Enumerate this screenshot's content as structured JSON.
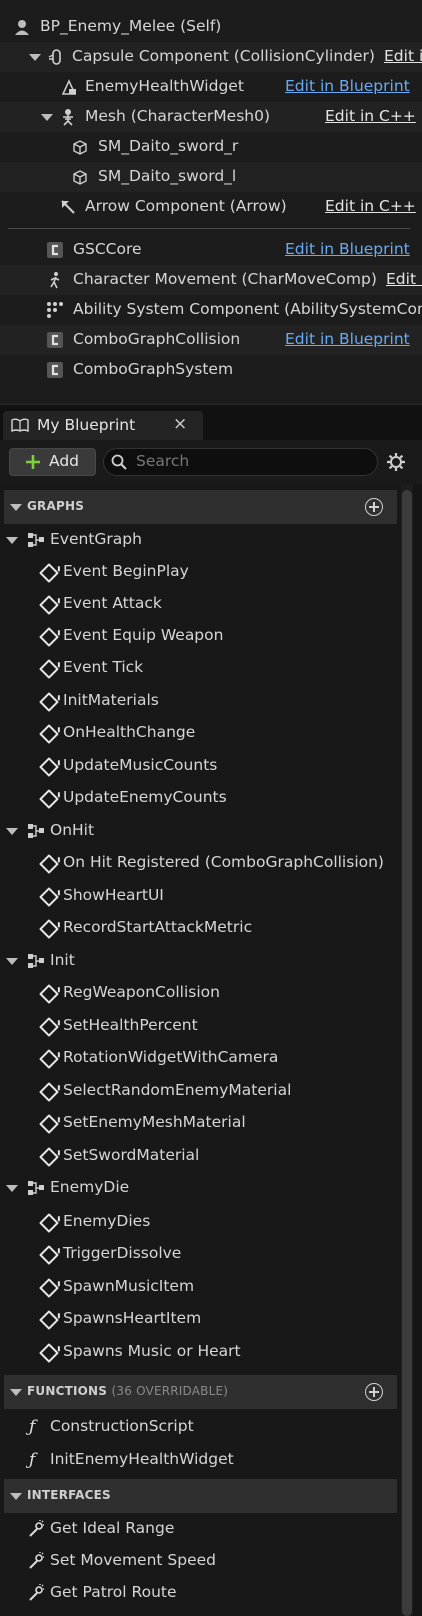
{
  "components": {
    "root": {
      "label": "BP_Enemy_Melee (Self)",
      "icon": "person-icon"
    },
    "items": [
      {
        "label": "Capsule Component (CollisionCylinder)",
        "link": "Edit in C++",
        "icon": "capsule-icon"
      },
      {
        "label": "EnemyHealthWidget",
        "link": "Edit in Blueprint",
        "icon": "widget-icon"
      },
      {
        "label": "Mesh (CharacterMesh0)",
        "link": "Edit in C++",
        "icon": "skeleton-icon"
      },
      {
        "label": "SM_Daito_sword_r",
        "icon": "static-mesh-icon"
      },
      {
        "label": "SM_Daito_sword_l",
        "icon": "static-mesh-icon"
      },
      {
        "label": "Arrow Component (Arrow)",
        "link": "Edit in C++",
        "icon": "arrow-icon"
      },
      {
        "label": "GSCCore",
        "link": "Edit in Blueprint",
        "icon": "component-icon"
      },
      {
        "label": "Character Movement (CharMoveComp)",
        "link": "Edit in C++",
        "icon": "movement-icon"
      },
      {
        "label": "Ability System Component (AbilitySystemComponent)",
        "icon": "ability-system-icon"
      },
      {
        "label": "ComboGraphCollision",
        "link": "Edit in Blueprint",
        "icon": "component-icon"
      },
      {
        "label": "ComboGraphSystem",
        "icon": "component-icon"
      }
    ]
  },
  "tab": {
    "title": "My Blueprint",
    "close": "×"
  },
  "toolbar": {
    "add_label": "Add",
    "search_placeholder": "Search"
  },
  "sections": {
    "graphs": {
      "label": "GRAPHS"
    },
    "functions": {
      "label": "FUNCTIONS",
      "sub": "(36 OVERRIDABLE)"
    },
    "interfaces": {
      "label": "INTERFACES"
    }
  },
  "graphs": [
    {
      "name": "EventGraph",
      "events": [
        "Event BeginPlay",
        "Event Attack",
        "Event Equip Weapon",
        "Event Tick",
        "InitMaterials",
        "OnHealthChange",
        "UpdateMusicCounts",
        "UpdateEnemyCounts"
      ]
    },
    {
      "name": "OnHit",
      "events": [
        "On Hit Registered (ComboGraphCollision)",
        "ShowHeartUI",
        "RecordStartAttackMetric"
      ]
    },
    {
      "name": "Init",
      "events": [
        "RegWeaponCollision",
        "SetHealthPercent",
        "RotationWidgetWithCamera",
        "SelectRandomEnemyMaterial",
        "SetEnemyMeshMaterial",
        "SetSwordMaterial"
      ]
    },
    {
      "name": "EnemyDie",
      "events": [
        "EnemyDies",
        "TriggerDissolve",
        "SpawnMusicItem",
        "SpawnsHeartItem",
        "Spawns Music or Heart"
      ]
    }
  ],
  "functions": [
    "ConstructionScript",
    "InitEnemyHealthWidget"
  ],
  "interfaces": [
    "Get Ideal Range",
    "Set Movement Speed",
    "Get Patrol Route"
  ],
  "colors": {
    "link": "#6aaaf2",
    "add_plus": "#7fcf3f",
    "panel_bg": "#181818"
  }
}
